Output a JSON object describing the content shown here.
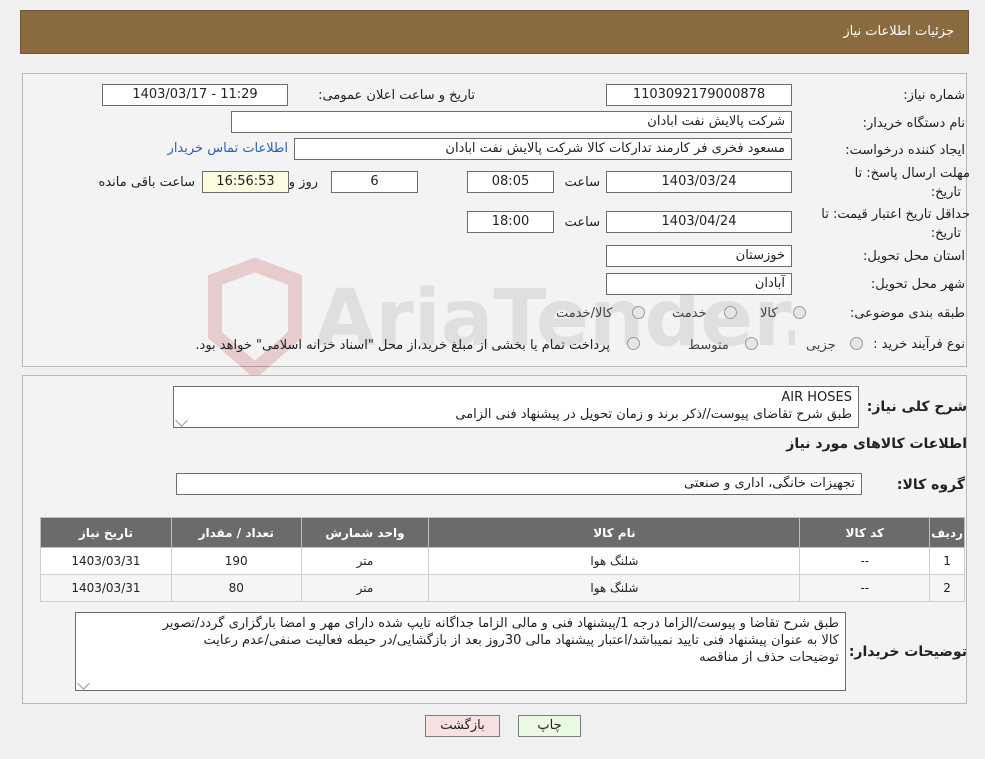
{
  "header": {
    "title": "جزئیات اطلاعات نیاز"
  },
  "watermark": {
    "text": "AriaTender.neT"
  },
  "fields": {
    "need_number": {
      "label": "شماره نیاز:",
      "value": "1103092179000878"
    },
    "public_announce": {
      "label": "تاریخ و ساعت اعلان عمومی:",
      "value": "1403/03/17 - 11:29"
    },
    "buyer_org": {
      "label": "نام دستگاه خریدار:",
      "value": "شرکت پالایش نفت ابادان"
    },
    "requester": {
      "label": "ایجاد کننده درخواست:",
      "value": "مسعود فخری فر کارمند تدارکات کالا شرکت پالایش نفت ابادان",
      "link": "اطلاعات تماس خریدار"
    },
    "reply_deadline": {
      "label_line1": "مهلت ارسال پاسخ: تا",
      "label_line2": "تاریخ:",
      "date": "1403/03/24",
      "time_label": "ساعت",
      "time": "08:05",
      "days": "6",
      "days_label": "روز و",
      "remaining": "16:56:53",
      "remaining_label": "ساعت باقی مانده"
    },
    "price_validity": {
      "label_line1": "حداقل تاریخ اعتبار قیمت: تا",
      "label_line2": "تاریخ:",
      "date": "1403/04/24",
      "time_label": "ساعت",
      "time": "18:00"
    },
    "province": {
      "label": "استان محل تحویل:",
      "value": "خوزستان"
    },
    "city": {
      "label": "شهر محل تحویل:",
      "value": "آبادان"
    },
    "category": {
      "label": "طبقه بندی موضوعی:",
      "options": [
        "کالا",
        "خدمت",
        "کالا/خدمت"
      ]
    },
    "purchase_type": {
      "label": "نوع فرآیند خرید :",
      "options": [
        "جزیی",
        "متوسط"
      ],
      "note": "پرداخت تمام یا بخشی از مبلغ خرید،از محل \"اسناد خزانه اسلامی\" خواهد بود."
    }
  },
  "summary": {
    "label": "شرح کلی نیاز:",
    "line1": "AIR HOSES",
    "line2": "طبق شرح تقاضای پیوست//ذکر برند و زمان تحویل در پیشنهاد فنی الزامی"
  },
  "goods_info": {
    "title": "اطلاعات کالاهای مورد نیاز"
  },
  "goods_group": {
    "label": "گروه کالا:",
    "value": "تجهیزات خانگی، اداری و صنعتی"
  },
  "table": {
    "headers": [
      "ردیف",
      "کد کالا",
      "نام کالا",
      "واحد شمارش",
      "تعداد / مقدار",
      "تاریخ نیاز"
    ],
    "rows": [
      [
        "1",
        "--",
        "شلنگ هوا",
        "متر",
        "190",
        "1403/03/31"
      ],
      [
        "2",
        "--",
        "شلنگ هوا",
        "متر",
        "80",
        "1403/03/31"
      ]
    ]
  },
  "buyer_notes": {
    "label": "توضیحات خریدار:",
    "line1": "طبق شرح تقاضا و پیوست/الزاما درجه 1/پیشنهاد فنی و مالی الزاما جداگانه تایپ شده دارای مهر و امضا بارگزاری گردد/تصویر",
    "line2": "کالا به عنوان پیشنهاد فنی تایید نمیباشد/اعتبار پیشنهاد مالی 30روز بعد از بازگشایی/در حیطه فعالیت صنفی/عدم رعایت",
    "line3": "توضیحات حذف از مناقصه"
  },
  "buttons": {
    "print": "چاپ",
    "back": "بازگشت"
  },
  "colors": {
    "header": "#8a6a3f",
    "table_header": "#6b6b6b",
    "print_btn": "#e9f9e4",
    "back_btn": "#f9e1e1",
    "link": "#2b5fb3"
  }
}
